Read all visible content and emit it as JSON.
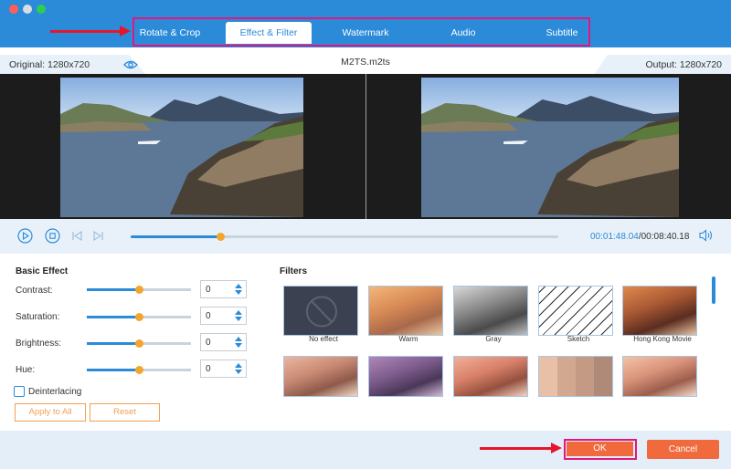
{
  "tabs": [
    {
      "label": "Rotate & Crop",
      "active": false
    },
    {
      "label": "Effect & Filter",
      "active": true
    },
    {
      "label": "Watermark",
      "active": false
    },
    {
      "label": "Audio",
      "active": false
    },
    {
      "label": "Subtitle",
      "active": false
    }
  ],
  "info": {
    "original": "Original: 1280x720",
    "filename": "M2TS.m2ts",
    "output": "Output: 1280x720"
  },
  "player": {
    "current_time": "00:01:48.04",
    "total_time": "/00:08:40.18",
    "progress": 0.21
  },
  "basic_effect": {
    "title": "Basic Effect",
    "items": [
      {
        "label": "Contrast:",
        "value": "0",
        "level": 0.5
      },
      {
        "label": "Saturation:",
        "value": "0",
        "level": 0.5
      },
      {
        "label": "Brightness:",
        "value": "0",
        "level": 0.5
      },
      {
        "label": "Hue:",
        "value": "0",
        "level": 0.5
      }
    ],
    "deinterlacing_label": "Deinterlacing",
    "apply_all_label": "Apply to All",
    "reset_label": "Reset"
  },
  "filters": {
    "title": "Filters",
    "row1": [
      "No effect",
      "Warm",
      "Gray",
      "Sketch",
      "Hong Kong Movie"
    ]
  },
  "footer": {
    "ok_label": "OK",
    "cancel_label": "Cancel"
  },
  "colors": {
    "accent": "#2b8bd9",
    "highlight_box": "#e0177e",
    "arrow": "#e8152a",
    "button_orange": "#f06a3d",
    "slider_knob": "#f4a52c"
  }
}
